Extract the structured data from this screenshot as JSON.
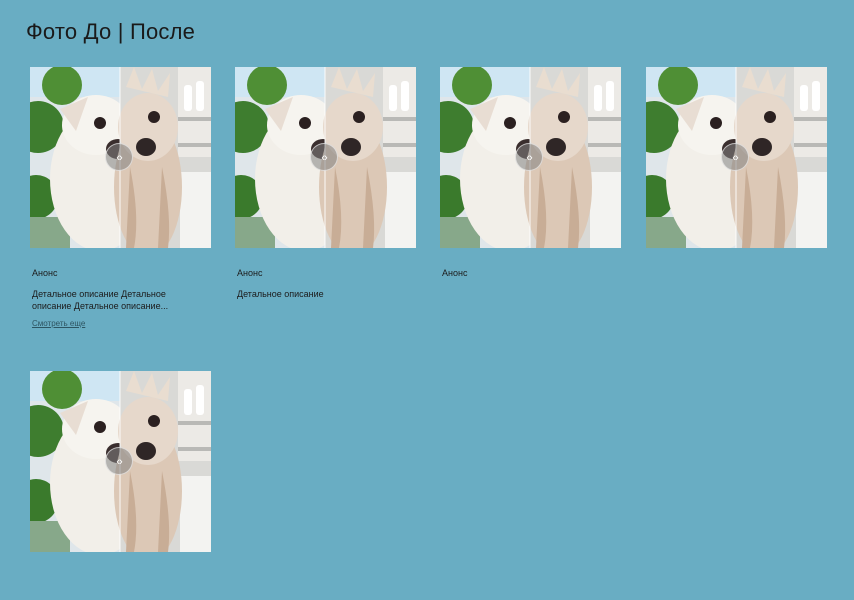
{
  "page": {
    "title": "Фото До | После"
  },
  "cards": [
    {
      "anons": "Анонс",
      "description": "Детальное описание Детальное описание Детальное описание...",
      "more_link": "Смотреть еще"
    },
    {
      "anons": "Анонс",
      "description": "Детальное описание"
    },
    {
      "anons": "Анонс"
    },
    {},
    {}
  ],
  "icons": {
    "slider_handle": "chevron-left-right-icon"
  },
  "colors": {
    "background": "#69adc3",
    "text": "#1c1c1c",
    "link": "#2d5562"
  }
}
